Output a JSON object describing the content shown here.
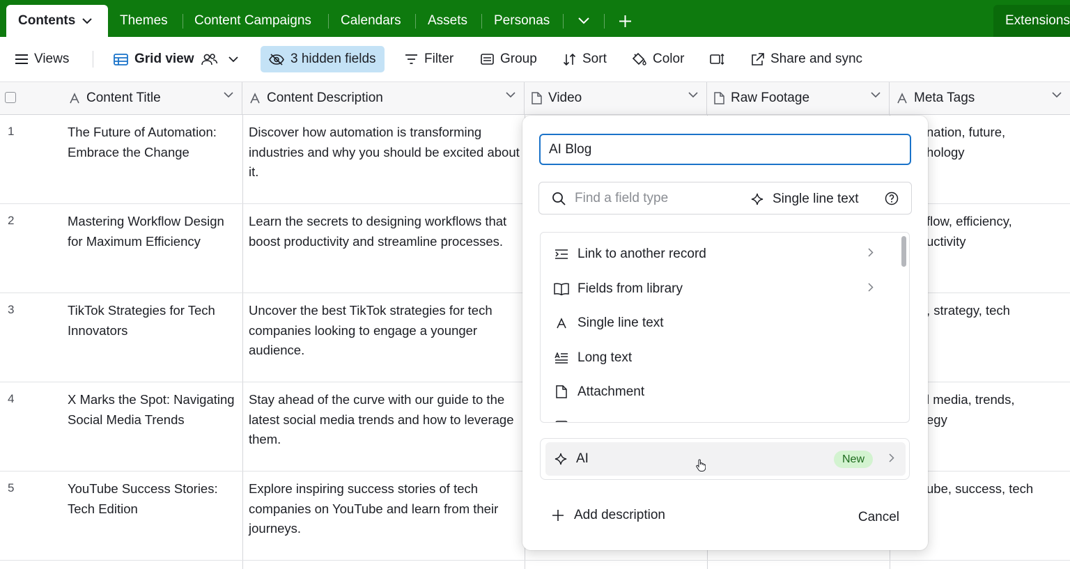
{
  "tabs": {
    "active": "Contents",
    "items": [
      "Themes",
      "Content Campaigns",
      "Calendars",
      "Assets",
      "Personas"
    ],
    "extensions": "Extensions"
  },
  "toolbar": {
    "views": "Views",
    "grid_view": "Grid view",
    "hidden_fields": "3 hidden fields",
    "filter": "Filter",
    "group": "Group",
    "sort": "Sort",
    "color": "Color",
    "share": "Share and sync"
  },
  "columns": {
    "title": "Content Title",
    "description": "Content Description",
    "video": "Video",
    "raw_footage": "Raw Footage",
    "meta_tags": "Meta Tags"
  },
  "rows": [
    {
      "num": "1",
      "title": "The Future of Automation: Embrace the Change",
      "description": "Discover how automation is transforming industries and why you should be excited about it.",
      "meta_line1": "nation, future,",
      "meta_line2": "hology"
    },
    {
      "num": "2",
      "title": "Mastering Workflow Design for Maximum Efficiency",
      "description": "Learn the secrets to designing workflows that boost productivity and streamline processes.",
      "meta_line1": "flow, efficiency,",
      "meta_line2": "uctivity"
    },
    {
      "num": "3",
      "title": "TikTok Strategies for Tech Innovators",
      "description": "Uncover the best TikTok strategies for tech companies looking to engage a younger audience.",
      "meta_line1": ", strategy, tech",
      "meta_line2": ""
    },
    {
      "num": "4",
      "title": "X Marks the Spot: Navigating Social Media Trends",
      "description": "Stay ahead of the curve with our guide to the latest social media trends and how to leverage them.",
      "meta_line1": "l media, trends,",
      "meta_line2": "egy"
    },
    {
      "num": "5",
      "title": "YouTube Success Stories: Tech Edition",
      "description": "Explore inspiring success stories of tech companies on YouTube and learn from their journeys.",
      "meta_line1": "ube, success, tech",
      "meta_line2": ""
    }
  ],
  "popup": {
    "field_name_value": "AI Blog",
    "search_placeholder": "Find a field type",
    "current_type": "Single line text",
    "field_types": [
      {
        "label": "Link to another record",
        "icon": "link-record-icon",
        "has_submenu": true
      },
      {
        "label": "Fields from library",
        "icon": "book-icon",
        "has_submenu": true
      },
      {
        "label": "Single line text",
        "icon": "text-a-icon",
        "has_submenu": false
      },
      {
        "label": "Long text",
        "icon": "long-text-icon",
        "has_submenu": false
      },
      {
        "label": "Attachment",
        "icon": "document-icon",
        "has_submenu": false
      }
    ],
    "ai_label": "AI",
    "ai_badge": "New",
    "add_description": "Add description",
    "cancel": "Cancel"
  },
  "colors": {
    "tabbar": "#0e7a0e",
    "hidden_fields_bg": "#c4e2f6",
    "input_focus": "#1a73c9",
    "new_badge_bg": "#d3f3d0"
  }
}
